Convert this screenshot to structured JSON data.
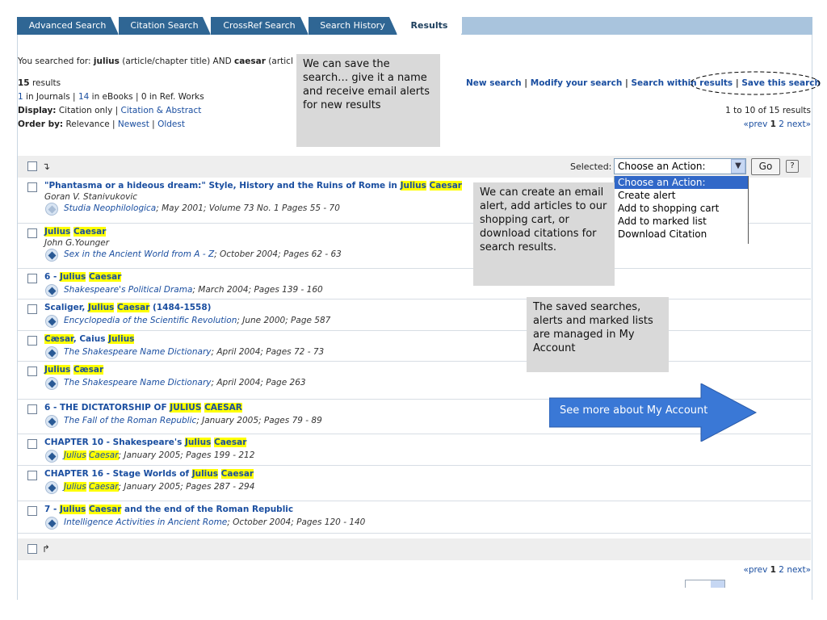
{
  "tabs": [
    {
      "label": "Advanced Search",
      "active": false
    },
    {
      "label": "Citation Search",
      "active": false
    },
    {
      "label": "CrossRef Search",
      "active": false
    },
    {
      "label": "Search History",
      "active": false
    },
    {
      "label": "Results",
      "active": true
    }
  ],
  "query": {
    "prefix": "You searched for: ",
    "term1": "julius",
    "field1": " (article/chapter title) AND ",
    "term2": "caesar",
    "field2": " (articl"
  },
  "summary": {
    "count": "15",
    "count_label": " results",
    "journals_count": "1",
    "journals_label": " in Journals | ",
    "ebooks_count": "14",
    "ebooks_label": " in eBooks | 0 in Ref. Works",
    "display_label": "Display:",
    "display_current": " Citation only | ",
    "display_alt": "Citation & Abstract",
    "order_label": "Order by:",
    "order_current": " Relevance | ",
    "order_newest": "Newest",
    "order_sep": " | ",
    "order_oldest": "Oldest"
  },
  "actions_links": {
    "new_search": "New search",
    "sep1": " | ",
    "modify": "Modify your search",
    "sep2": " | ",
    "within": "Search within results",
    "sep3": " | ",
    "save": "Save this search"
  },
  "pagination": {
    "range": "1 to 10 of 15 results",
    "prev": "«prev ",
    "current": "1",
    "next_page": " 2 ",
    "next": "next»"
  },
  "toolbar": {
    "selected_label": "Selected:",
    "select_value": "Choose an Action:",
    "go_label": "Go",
    "help_label": "?"
  },
  "dropdown_options": [
    "Choose an Action:",
    "Create alert",
    "Add to shopping cart",
    "Add to marked list",
    "Download Citation"
  ],
  "results": [
    {
      "title_parts": [
        {
          "t": "\"Phantasma or a hideous dream:\" Style, History and the Ruins of Rome in "
        },
        {
          "t": "Julius",
          "hl": true
        },
        {
          "t": " "
        },
        {
          "t": "Caesar",
          "hl": true
        }
      ],
      "author": "Goran V. Stanivukovic",
      "source": "Studia Neophilologica",
      "details": "; May 2001; Volume 73 No. 1 Pages 55 - 70"
    },
    {
      "title_parts": [
        {
          "t": "Julius",
          "hl": true
        },
        {
          "t": " "
        },
        {
          "t": "Caesar",
          "hl": true
        }
      ],
      "author": "John G.Younger",
      "source": "Sex in the Ancient World from A - Z",
      "details": "; October 2004; Pages 62 - 63"
    },
    {
      "title_parts": [
        {
          "t": "6 - "
        },
        {
          "t": "Julius",
          "hl": true
        },
        {
          "t": " "
        },
        {
          "t": "Caesar",
          "hl": true
        }
      ],
      "author": "",
      "source": "Shakespeare's Political Drama",
      "details": "; March 2004; Pages 139 - 160"
    },
    {
      "title_parts": [
        {
          "t": "Scaliger, "
        },
        {
          "t": "Julius",
          "hl": true
        },
        {
          "t": " "
        },
        {
          "t": "Caesar",
          "hl": true
        },
        {
          "t": " (1484-1558)"
        }
      ],
      "author": "",
      "source": "Encyclopedia of the Scientific Revolution",
      "details": "; June 2000; Page 587"
    },
    {
      "title_parts": [
        {
          "t": "Cæsar",
          "hl": true
        },
        {
          "t": ", Caius "
        },
        {
          "t": "Julius",
          "hl": true
        }
      ],
      "author": "",
      "source": "The Shakespeare Name Dictionary",
      "details": "; April 2004; Pages 72 - 73"
    },
    {
      "title_parts": [
        {
          "t": "Julius",
          "hl": true
        },
        {
          "t": " "
        },
        {
          "t": "Cæsar",
          "hl": true
        }
      ],
      "author": "",
      "source": "The Shakespeare Name Dictionary",
      "details": "; April 2004; Page 263"
    },
    {
      "title_parts": [
        {
          "t": "6 - THE DICTATORSHIP OF "
        },
        {
          "t": "JULIUS",
          "hl": true
        },
        {
          "t": " "
        },
        {
          "t": "CAESAR",
          "hl": true
        }
      ],
      "author": "",
      "source": "The Fall of the Roman Republic",
      "details": "; January 2005; Pages 79 - 89"
    },
    {
      "title_parts": [
        {
          "t": "CHAPTER 10 - Shakespeare's "
        },
        {
          "t": "Julius",
          "hl": true
        },
        {
          "t": " "
        },
        {
          "t": "Caesar",
          "hl": true
        }
      ],
      "author": "",
      "source_parts": [
        {
          "t": "Julius",
          "hl": true
        },
        {
          "t": " "
        },
        {
          "t": "Caesar",
          "hl": true
        }
      ],
      "source": "",
      "details": "; January 2005; Pages 199 - 212"
    },
    {
      "title_parts": [
        {
          "t": "CHAPTER 16 - Stage Worlds of "
        },
        {
          "t": "Julius",
          "hl": true
        },
        {
          "t": " "
        },
        {
          "t": "Caesar",
          "hl": true
        }
      ],
      "author": "",
      "source_parts": [
        {
          "t": "Julius",
          "hl": true
        },
        {
          "t": " "
        },
        {
          "t": "Caesar",
          "hl": true
        }
      ],
      "source": "",
      "details": "; January 2005; Pages 287 - 294"
    },
    {
      "title_parts": [
        {
          "t": "7 - "
        },
        {
          "t": "Julius",
          "hl": true
        },
        {
          "t": " "
        },
        {
          "t": "Caesar",
          "hl": true
        },
        {
          "t": " and the end of the Roman Republic"
        }
      ],
      "author": "",
      "source": "Intelligence Activities in Ancient Rome",
      "details": "; October 2004; Pages 120 - 140"
    }
  ],
  "callouts": {
    "save_search": "We can save the search… give it a name and receive email alerts for new results",
    "email_alert": "We can create an email alert, add articles to our shopping cart, or download citations for search results.",
    "my_account": "The saved searches, alerts and marked lists are managed in My Account",
    "see_more": "See more about My Account"
  },
  "colors": {
    "tab_bg": "#2f6694",
    "tab_strip": "#a9c4dd",
    "link": "#1a4ea0",
    "highlight": "#ffff00",
    "callout_bg": "#d9d9d9",
    "arrow_blue": "#3a78d6",
    "toolbar_bg": "#eeeeee"
  },
  "icons": {
    "checkbox": "checkbox",
    "select_all_arrow": "arrow-down-right-icon",
    "result_type": "diamond-badge-icon",
    "dropdown_arrow": "chevron-down-icon",
    "help": "question-icon"
  }
}
